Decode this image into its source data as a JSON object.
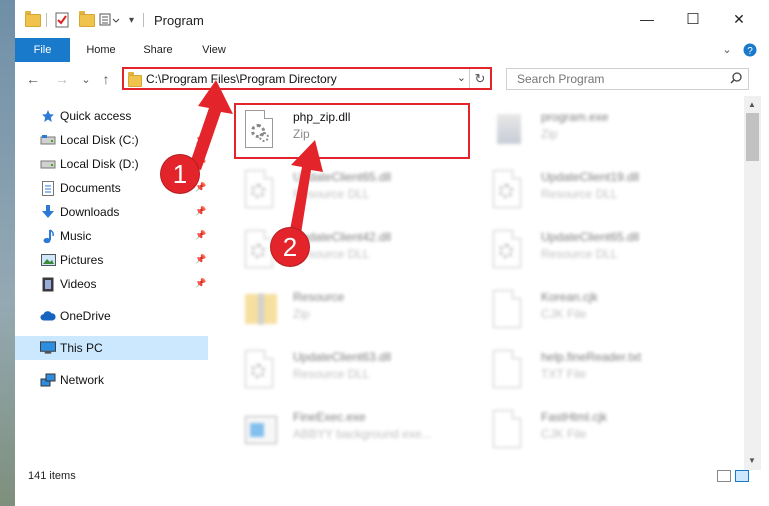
{
  "window": {
    "title": "Program",
    "controls": {
      "minimize": "—",
      "maximize": "☐",
      "close": "✕"
    }
  },
  "ribbon": {
    "tabs": [
      "File",
      "Home",
      "Share",
      "View"
    ],
    "expand_icon": "chevron-down-icon",
    "help_icon": "help-icon"
  },
  "navigation": {
    "back": "←",
    "forward": "→",
    "recent": "⌄",
    "up": "↑",
    "address_path": "C:\\Program Files\\Program Directory",
    "search_placeholder": "Search Program"
  },
  "sidebar": {
    "items": [
      {
        "label": "Quick access",
        "icon": "star-icon",
        "pinned": false
      },
      {
        "label": "Local Disk (C:)",
        "icon": "drive-icon",
        "pinned": true
      },
      {
        "label": "Local Disk (D:)",
        "icon": "drive-icon",
        "pinned": true
      },
      {
        "label": "Documents",
        "icon": "documents-icon",
        "pinned": true
      },
      {
        "label": "Downloads",
        "icon": "download-icon",
        "pinned": true
      },
      {
        "label": "Music",
        "icon": "music-icon",
        "pinned": true
      },
      {
        "label": "Pictures",
        "icon": "pictures-icon",
        "pinned": true
      },
      {
        "label": "Videos",
        "icon": "videos-icon",
        "pinned": true
      },
      {
        "label": "OneDrive",
        "icon": "cloud-icon",
        "pinned": false
      },
      {
        "label": "This PC",
        "icon": "computer-icon",
        "pinned": false,
        "selected": true
      },
      {
        "label": "Network",
        "icon": "network-icon",
        "pinned": false
      }
    ]
  },
  "files": [
    {
      "name": "php_zip.dll",
      "type": "Zip",
      "icon": "dll-gear-icon",
      "highlighted": true
    },
    {
      "name": "program.exe",
      "type": "Zip",
      "icon": "exe-icon"
    },
    {
      "name": "UpdateClient65.dll",
      "type": "Resource DLL",
      "icon": "dll-gear-icon"
    },
    {
      "name": "UpdateClient19.dll",
      "type": "Resource DLL",
      "icon": "dll-gear-icon"
    },
    {
      "name": "UpdateClient42.dll",
      "type": "Resource DLL",
      "icon": "dll-gear-icon"
    },
    {
      "name": "UpdateClient65.dll",
      "type": "Resource DLL",
      "icon": "dll-gear-icon"
    },
    {
      "name": "Resource",
      "type": "Zip",
      "icon": "zip-folder-icon"
    },
    {
      "name": "Korean.cjk",
      "type": "CJK File",
      "icon": "file-icon"
    },
    {
      "name": "UpdateClient63.dll",
      "type": "Resource DLL",
      "icon": "dll-gear-icon"
    },
    {
      "name": "help.fineReader.txt",
      "type": "TXT File",
      "icon": "file-icon"
    },
    {
      "name": "FineExec.exe",
      "type": "ABBYY background exe...",
      "icon": "app-icon"
    },
    {
      "name": "FastHtml.cjk",
      "type": "CJK File",
      "icon": "file-icon"
    }
  ],
  "status": {
    "item_count": "141 items"
  },
  "annotations": {
    "step1": "1",
    "step2": "2",
    "color": "#e3252b"
  }
}
